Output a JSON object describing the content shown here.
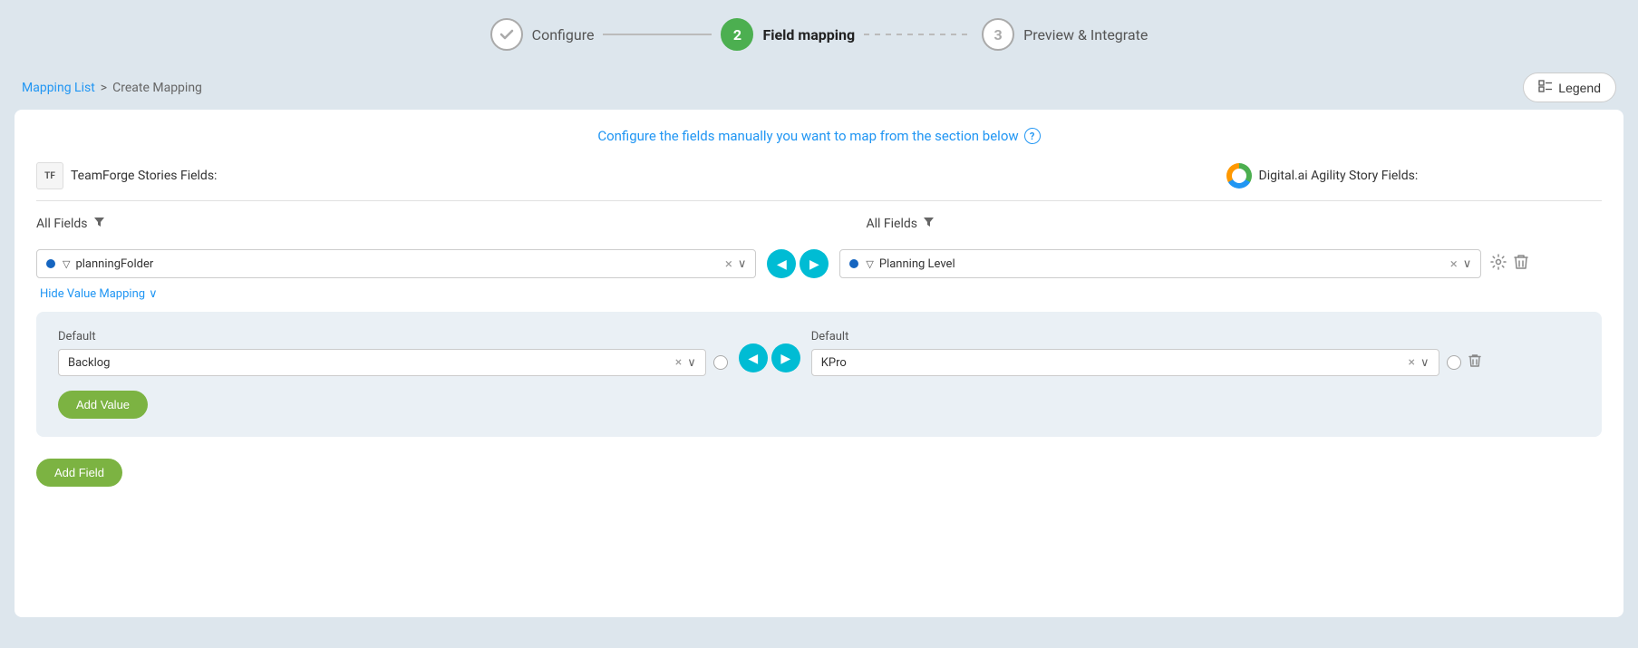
{
  "stepper": {
    "steps": [
      {
        "id": "configure",
        "number": "✓",
        "label": "Configure",
        "state": "completed"
      },
      {
        "id": "field-mapping",
        "number": "2",
        "label": "Field mapping",
        "state": "active"
      },
      {
        "id": "preview",
        "number": "3",
        "label": "Preview & Integrate",
        "state": "pending"
      }
    ]
  },
  "breadcrumb": {
    "link_label": "Mapping List",
    "separator": ">",
    "current": "Create Mapping"
  },
  "legend_button": "Legend",
  "instruction": "Configure the fields manually you want to map from the section below",
  "source_header": "TeamForge Stories Fields:",
  "target_header": "Digital.ai Agility Story Fields:",
  "source_logo_text": "TF",
  "all_fields_label": "All Fields",
  "source_field": {
    "dot_color": "#1565c0",
    "funnel_text": "▽",
    "value": "planningFolder",
    "clear_label": "×",
    "chevron": "∨"
  },
  "target_field": {
    "dot_color": "#1565c0",
    "funnel_text": "▽",
    "value": "Planning Level",
    "clear_label": "×",
    "chevron": "∨"
  },
  "hide_mapping_toggle": "Hide Value Mapping",
  "value_mapping": {
    "left_default_label": "Default",
    "right_default_label": "Default",
    "left_value": "Backlog",
    "right_value": "KPro",
    "add_value_label": "Add Value"
  },
  "add_field_label": "Add Field",
  "nav": {
    "back_icon": "◀",
    "forward_icon": "▶"
  }
}
